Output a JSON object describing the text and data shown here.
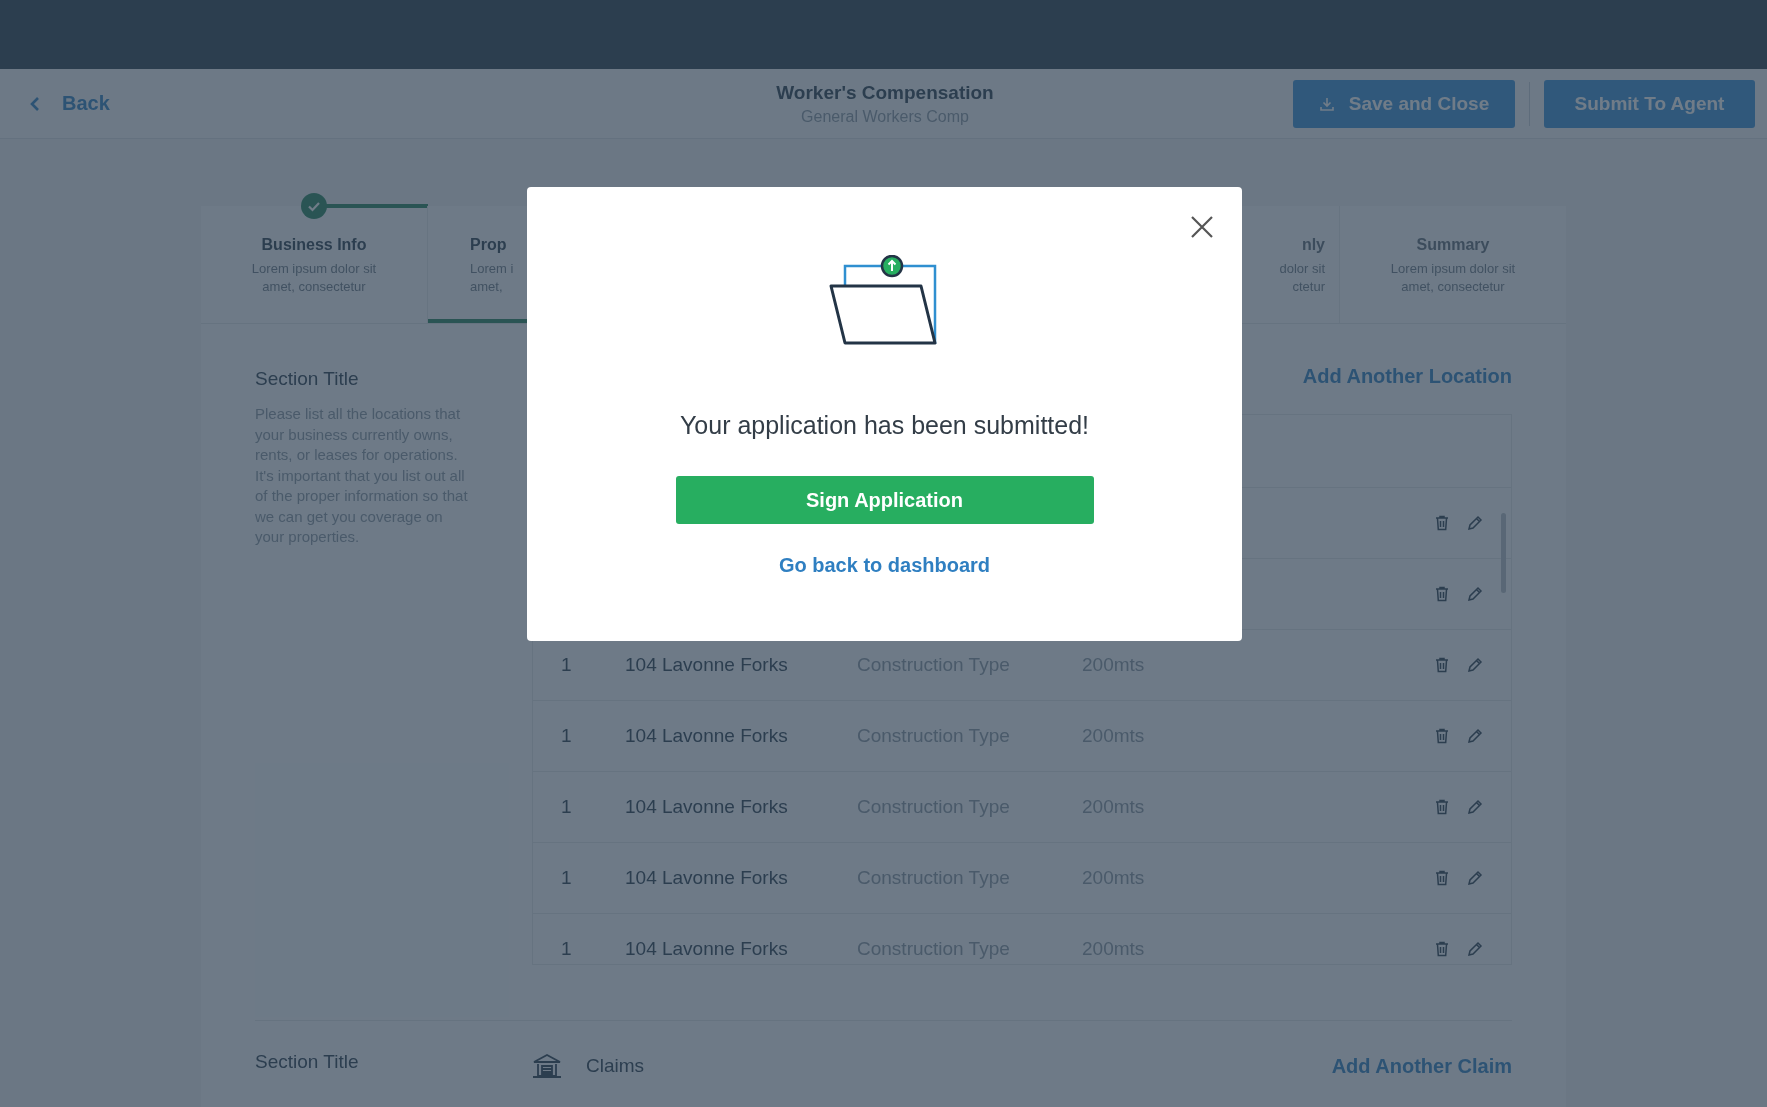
{
  "header": {
    "back": "Back",
    "title": "Worker's Compensation",
    "subtitle": "General Workers Comp",
    "buttons": [
      {
        "label": "Save and Close",
        "kind": "save"
      },
      {
        "label": "Submit To Agent",
        "kind": "submit"
      }
    ]
  },
  "steps": [
    {
      "title": "Business Info",
      "lines": [
        "Lorem ipsum dolor sit",
        "amet, consectetur"
      ],
      "completed": true,
      "selected": false
    },
    {
      "title": "Prop",
      "lines": [
        "Lorem i",
        "amet,"
      ],
      "completed": false,
      "selected": true
    },
    {
      "title": "nly",
      "lines": [
        "dolor sit",
        "ctetur"
      ],
      "completed": false,
      "selected": false
    },
    {
      "title": "Summary",
      "lines": [
        "Lorem ipsum dolor sit",
        "amet, consectetur"
      ],
      "completed": false,
      "selected": false
    }
  ],
  "sections": [
    {
      "title": "Section Title",
      "description": "Please list all the locations that your business currently owns, rents, or leases for operations. It's important that you list out all of the proper information so that we can get you coverage on your properties.",
      "action": "Add Another Location",
      "table": {
        "rows": [
          {},
          {},
          {
            "number": "1",
            "address": "104 Lavonne Forks",
            "type": "Construction Type",
            "size": "200mts"
          },
          {
            "number": "1",
            "address": "104 Lavonne Forks",
            "type": "Construction Type",
            "size": "200mts"
          },
          {
            "number": "1",
            "address": "104 Lavonne Forks",
            "type": "Construction Type",
            "size": "200mts"
          },
          {
            "number": "1",
            "address": "104 Lavonne Forks",
            "type": "Construction Type",
            "size": "200mts"
          },
          {
            "number": "1",
            "address": "104 Lavonne Forks",
            "type": "Construction Type",
            "size": "200mts"
          }
        ]
      }
    },
    {
      "title": "Section Title",
      "heading": "Claims",
      "action": "Add Another Claim"
    }
  ],
  "modal": {
    "message": "Your application has been submitted!",
    "primary": "Sign Application",
    "link": "Go back to dashboard"
  }
}
